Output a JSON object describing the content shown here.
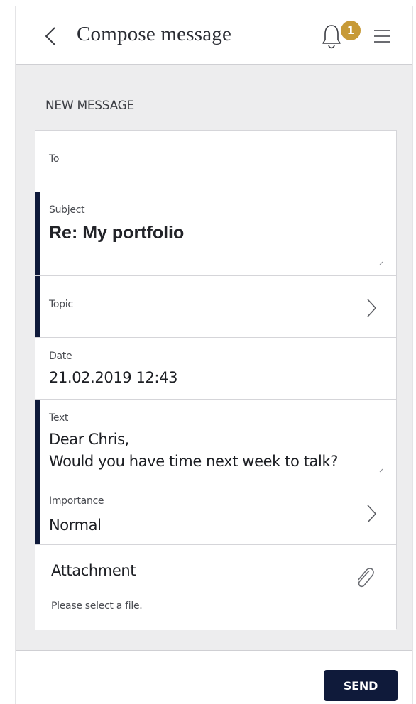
{
  "header": {
    "title": "Compose message",
    "notification_count": "1",
    "back_icon": "chevron-left-icon",
    "bell_icon": "bell-icon",
    "menu_icon": "hamburger-menu-icon"
  },
  "section_title": "NEW MESSAGE",
  "form": {
    "to": {
      "label": "To",
      "value": ""
    },
    "subject": {
      "label": "Subject",
      "value": "Re: My portfolio"
    },
    "topic": {
      "label": "Topic",
      "value": ""
    },
    "date": {
      "label": "Date",
      "value": "21.02.2019 12:43"
    },
    "text": {
      "label": "Text",
      "line1": "Dear Chris,",
      "line2": "Would you have time next week to talk?"
    },
    "importance": {
      "label": "Importance",
      "value": "Normal"
    },
    "attachment": {
      "label": "Attachment",
      "hint": "Please select a file.",
      "icon": "paperclip-icon"
    }
  },
  "footer": {
    "send_label": "SEND"
  },
  "colors": {
    "accent": "#0f1a3a",
    "badge": "#c79a37",
    "background": "#ededee"
  }
}
